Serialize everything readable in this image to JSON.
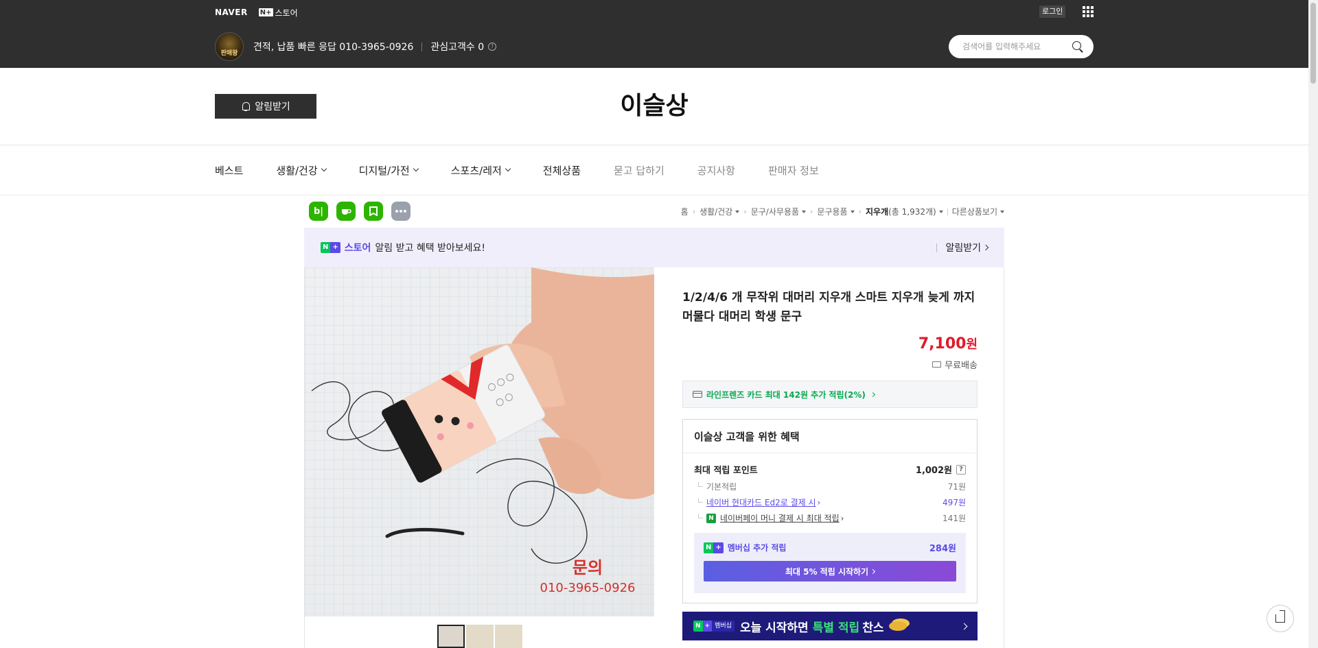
{
  "topbar": {
    "naver_logo": "NAVER",
    "nstore_badge": "N+",
    "nstore_label": "스토어",
    "login": "로그인",
    "seller_avatar_text": "판매왕",
    "seller_desc": "견적, 납품 빠른 응답 010-3965-0926",
    "fav_label": "관심고객수 0",
    "search_placeholder": "검색어를 입력해주세요"
  },
  "store": {
    "notify_btn": "알림받기",
    "title": "이슬상"
  },
  "nav": {
    "items": [
      {
        "label": "베스트"
      },
      {
        "label": "생활/건강"
      },
      {
        "label": "디지털/가전"
      },
      {
        "label": "스포츠/레저"
      },
      {
        "label": "전체상품"
      },
      {
        "label": "묻고 답하기"
      },
      {
        "label": "공지사항"
      },
      {
        "label": "판매자 정보"
      }
    ]
  },
  "share": {
    "blog": "b|",
    "icons": [
      "blog-icon",
      "cafe-icon",
      "bookmark-icon",
      "more-icon"
    ]
  },
  "breadcrumb": {
    "home": "홈",
    "c1": "생활/건강",
    "c2": "문구/사무용품",
    "c3": "문구용품",
    "c4": "지우개",
    "c4_count": "(총 1,932개)",
    "other": "다른상품보기"
  },
  "promo": {
    "badge_n": "N",
    "badge_p": "+",
    "store": "스토어",
    "text": "알림 받고 혜택 받아보세요!",
    "action": "알림받기"
  },
  "product": {
    "caption_title": "문의",
    "caption_phone": "010-3965-0926",
    "name": "1/2/4/6 개 무작위 대머리 지우개 스마트 지우개 늦게 까지 머물다 대머리 학생 문구",
    "price": "7,100",
    "price_unit": "원",
    "shipping": "무료배송",
    "card_benefit": "라인프렌즈 카드 최대 142원 추가 적립(2%)"
  },
  "benefits": {
    "title": "이슬상 고객을 위한 혜택",
    "max_label": "최대 적립 포인트",
    "max_val": "1,002원",
    "q": "?",
    "basic_label": "기본적립",
    "basic_val": "71원",
    "hyundai_label": "네이버 현대카드 Ed2로 결제 시",
    "hyundai_val": "497원",
    "npay_icon": "N",
    "npay_label": "네이버페이 머니 결제 시 최대 적립",
    "npay_val": "141원",
    "member_label": "멤버십 추가 적립",
    "member_val": "284원",
    "member_btn": "최대 5% 적립 시작하기"
  },
  "bottom_banner": {
    "badge_m": "멤버십",
    "text": "오늘 시작하면",
    "highlight": "특별 적립",
    "tail": "찬스"
  },
  "colors": {
    "topbar": "#2f2f2f",
    "price": "#e01a2c",
    "naver_green": "#03c75a",
    "plus_purple": "#5b4ae8",
    "banner_navy": "#1e1a7a"
  }
}
